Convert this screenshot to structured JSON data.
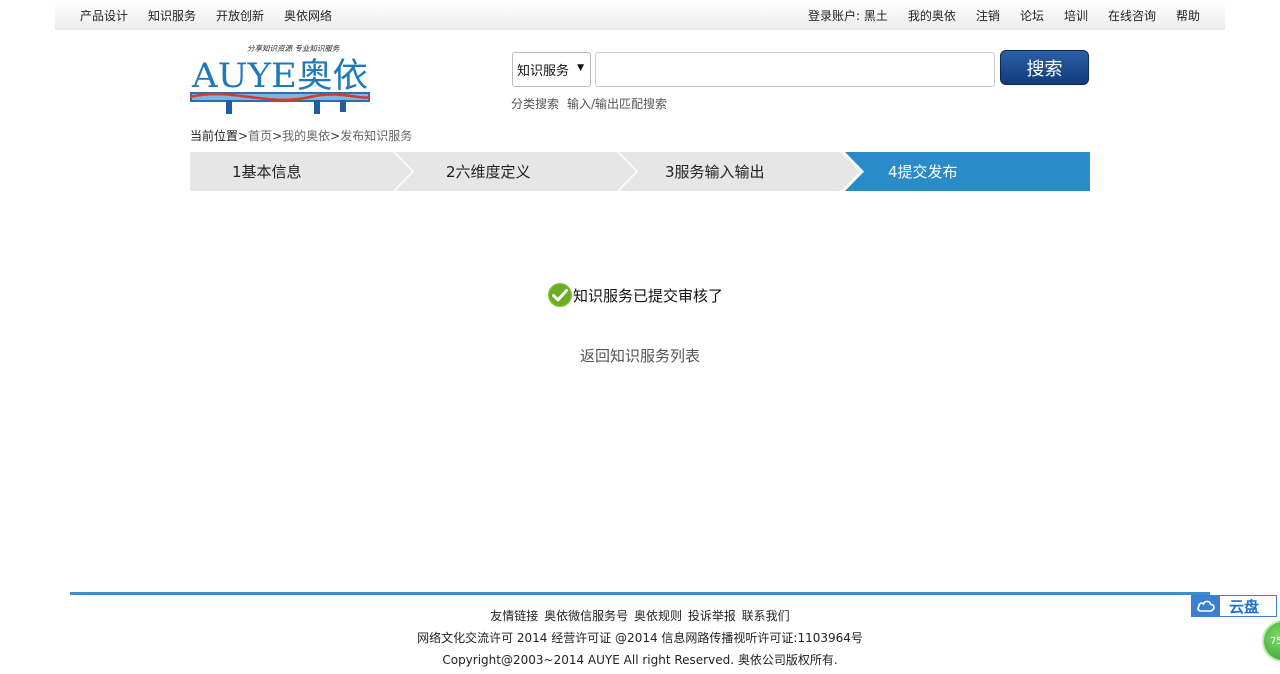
{
  "topnav": {
    "left": [
      "产品设计",
      "知识服务",
      "开放创新",
      "奥依网络"
    ],
    "account": "登录账户: 黑土",
    "right": [
      "我的奥依",
      "注销",
      "论坛",
      "培训",
      "在线咨询",
      "帮助"
    ]
  },
  "logo": {
    "slogan": "分享知识资源 专业知识服务",
    "text": "AUYE奥依"
  },
  "search": {
    "category": "知识服务",
    "button": "搜索",
    "links": [
      "分类搜索",
      "输入/输出匹配搜索"
    ]
  },
  "breadcrumb": {
    "label": "当前位置",
    "items": [
      "首页",
      "我的奥依",
      "发布知识服务"
    ]
  },
  "steps": [
    {
      "label": "1基本信息",
      "active": false
    },
    {
      "label": "2六维度定义",
      "active": false
    },
    {
      "label": "3服务输入输出",
      "active": false
    },
    {
      "label": "4提交发布",
      "active": true
    }
  ],
  "colors": {
    "step_inactive": "#e6e6e6",
    "step_active": "#2b8ac8",
    "accent": "#3b8fd0",
    "success": "#7cbf2f"
  },
  "main": {
    "message": "知识服务已提交审核了",
    "back_link": "返回知识服务列表"
  },
  "footer": {
    "links": [
      "友情链接",
      "奥依微信服务号",
      "奥依规则",
      "投诉举报",
      "联系我们"
    ],
    "license": "网络文化交流许可 2014 经营许可证 @2014 信息网路传播视听许可证:1103964号",
    "copyright": "Copyright@2003~2014 AUYE All right Reserved. 奥依公司版权所有."
  },
  "widgets": {
    "cloud_label": "云盘",
    "ball_text": "75"
  }
}
